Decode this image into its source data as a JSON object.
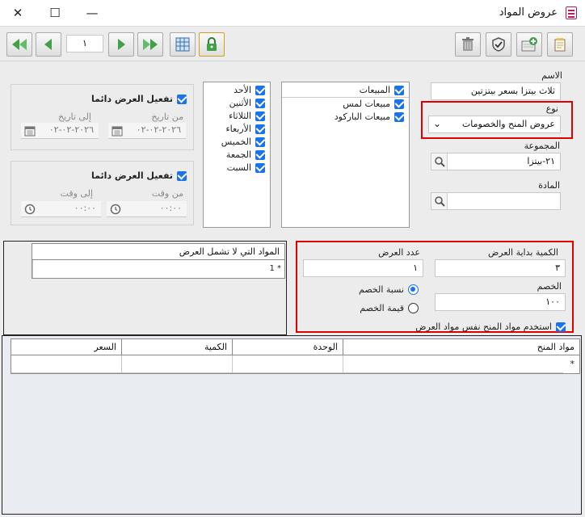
{
  "window": {
    "title": "عروض المواد",
    "minimize": "—",
    "maximize": "☐",
    "close": "✕"
  },
  "toolbar": {
    "page_number": "١"
  },
  "name": {
    "label": "الاسم",
    "value": "ثلاث بيتزا بسعر بيتزتين"
  },
  "type": {
    "label": "نوع",
    "value": "عروض المنح والخصومات",
    "arrow": "⌄"
  },
  "group": {
    "label": "المجموعة",
    "value": "٢١-بيتزا"
  },
  "material": {
    "label": "المادة",
    "value": ""
  },
  "sales_types": [
    "المبيعات",
    "مبيعات لمس",
    "مبيعات الباركود"
  ],
  "days": [
    "الأحد",
    "الأثنين",
    "الثلاثاء",
    "الأربعاء",
    "الخميس",
    "الجمعة",
    "السبت"
  ],
  "date_activation": {
    "always_label": "تفعيل العرض دائما",
    "from_label": "من تاريخ",
    "to_label": "إلى تاريخ",
    "from_value": "٢٠٢٦-٠٢-٠٢",
    "to_value": "٢٠٢٦-٠٢-٠٢"
  },
  "time_activation": {
    "always_label": "تفعيل العرض دائما",
    "from_label": "من وقت",
    "to_label": "إلى وقت",
    "from_value": "٠٠:٠٠",
    "to_value": "٠٠:٠٠"
  },
  "excluded_grid": {
    "header": "المواد التي لا تشمل العرض",
    "row_marker": "* 1"
  },
  "offer": {
    "start_qty_label": "الكمية بداية العرض",
    "start_qty_value": "٣",
    "offer_count_label": "عدد العرض",
    "offer_count_value": "١",
    "discount_label": "الخصم",
    "discount_value": "١٠٠",
    "discount_percent_label": "نسبة الخصم",
    "discount_value_label": "قيمة الخصم",
    "use_same_label": "استخدم مواد المنح نفس مواد العرض"
  },
  "grant_grid": {
    "columns": [
      "مواد المنح",
      "الوحدة",
      "الكمية",
      "السعر"
    ],
    "row_marker": "*"
  }
}
